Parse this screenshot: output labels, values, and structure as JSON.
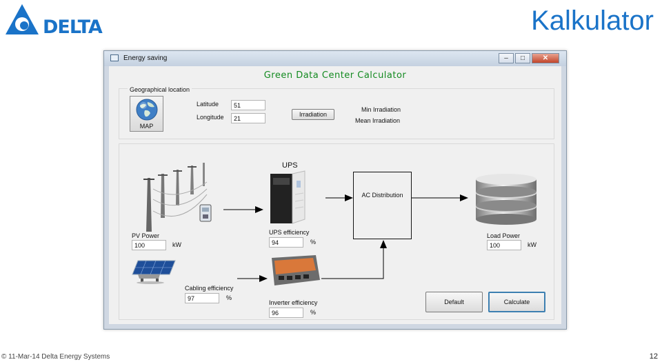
{
  "slide": {
    "logo_text": "DELTA",
    "title": "Kalkulator",
    "footer_left": "© 11-Mar-14 Delta Energy Systems",
    "page_number": "12",
    "colors": {
      "title": "#1a73c8",
      "logo": "#1a73c8",
      "app_title": "#138a20"
    }
  },
  "window": {
    "title": "Energy saving",
    "controls": {
      "minimize": "–",
      "maximize": "□",
      "close": "✕"
    },
    "app_title": "Green Data Center Calculator",
    "geo": {
      "group_label": "Geographical location",
      "map_button_label": "MAP",
      "latitude_label": "Latitude",
      "latitude_value": "51",
      "longitude_label": "Longitude",
      "longitude_value": "21",
      "irradiation_button": "Irradiation",
      "min_irradiation_label": "Min Irradiation",
      "mean_irradiation_label": "Mean Irradiation"
    },
    "flow": {
      "ups_title": "UPS",
      "ac_distribution": "AC Distribution",
      "pv_power_label": "PV Power",
      "pv_power_value": "100",
      "pv_power_unit": "kW",
      "ups_eff_label": "UPS efficiency",
      "ups_eff_value": "94",
      "ups_eff_unit": "%",
      "load_power_label": "Load Power",
      "load_power_value": "100",
      "load_power_unit": "kW",
      "cabling_eff_label": "Cabling efficiency",
      "cabling_eff_value": "97",
      "cabling_eff_unit": "%",
      "inverter_eff_label": "Inverter efficiency",
      "inverter_eff_value": "96",
      "inverter_eff_unit": "%",
      "default_button": "Default",
      "calculate_button": "Calculate"
    }
  }
}
